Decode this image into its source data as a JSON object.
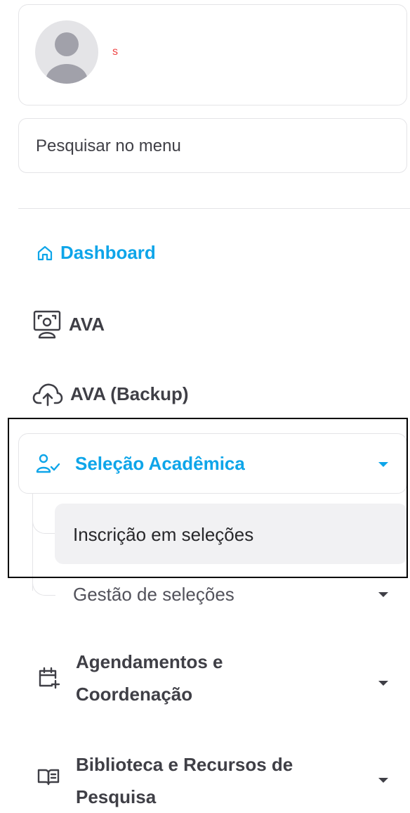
{
  "user": {
    "name": "s"
  },
  "search": {
    "placeholder": "Pesquisar no menu"
  },
  "nav": {
    "dashboard": "Dashboard",
    "ava": "AVA",
    "ava_backup": "AVA (Backup)"
  },
  "selecao": {
    "label": "Seleção Acadêmica",
    "items": [
      {
        "label": "Inscrição em seleções",
        "active": true
      },
      {
        "label": "Gestão de seleções",
        "active": false
      }
    ]
  },
  "groups": [
    {
      "label_line1": "Agendamentos e",
      "label_line2": "Coordenação",
      "icon": "calendar-plus-icon"
    },
    {
      "label_line1": "Biblioteca e Recursos de",
      "label_line2": "Pesquisa",
      "icon": "book-open-icon"
    }
  ],
  "colors": {
    "accent": "#0ea5e9",
    "text": "#3f3f46",
    "border": "#e4e4e7",
    "active_bg": "#f1f1f3"
  }
}
